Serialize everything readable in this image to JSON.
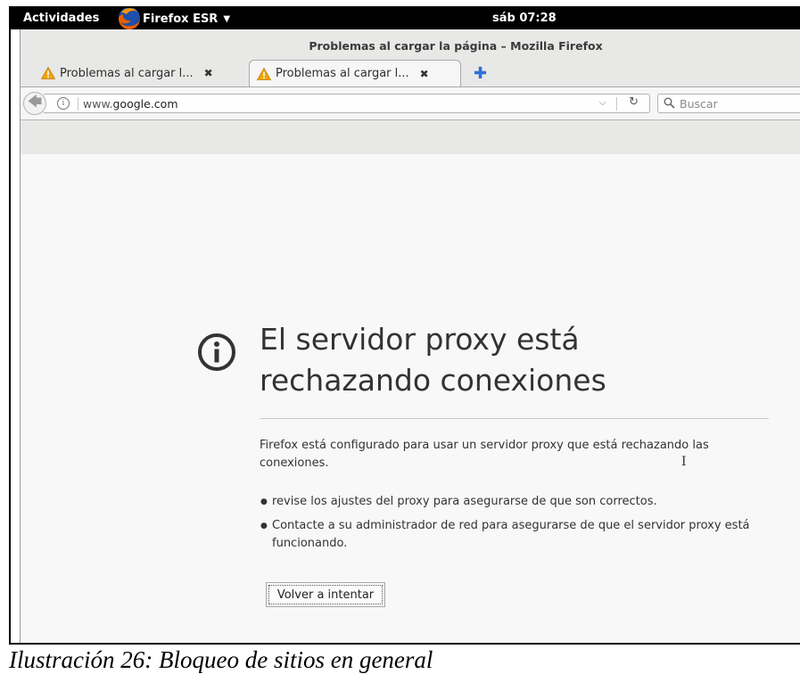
{
  "topbar": {
    "activities": "Actividades",
    "app_name": "Firefox ESR",
    "clock": "sáb 07:28"
  },
  "window": {
    "title": "Problemas al cargar la página – Mozilla Firefox"
  },
  "tabs": [
    {
      "label": "Problemas al cargar l...",
      "active": false
    },
    {
      "label": "Problemas al cargar l...",
      "active": true
    }
  ],
  "navbar": {
    "url_prefix": "www.",
    "url_domain": "google.com",
    "search_placeholder": "Buscar"
  },
  "error_page": {
    "title": "El servidor proxy está rechazando conexiones",
    "description": "Firefox está configurado para usar un servidor proxy que está rechazando las conexiones.",
    "suggestions": [
      "revise los ajustes del proxy para asegurarse de que son correctos.",
      "Contacte a su administrador de red para asegurarse de que el servidor proxy está funcionando."
    ],
    "retry_button": "Volver a intentar"
  },
  "caption": "Ilustración 26: Bloqueo de sitios en general",
  "colors": {
    "topbar_bg": "#000000",
    "warning": "#f0a30a",
    "new_tab_accent": "#2f6fd6"
  },
  "icons": [
    "firefox-logo-icon",
    "warning-icon",
    "close-icon",
    "plus-icon",
    "back-arrow-icon",
    "info-icon",
    "dropdown-icon",
    "reload-icon",
    "search-icon",
    "error-info-icon"
  ]
}
